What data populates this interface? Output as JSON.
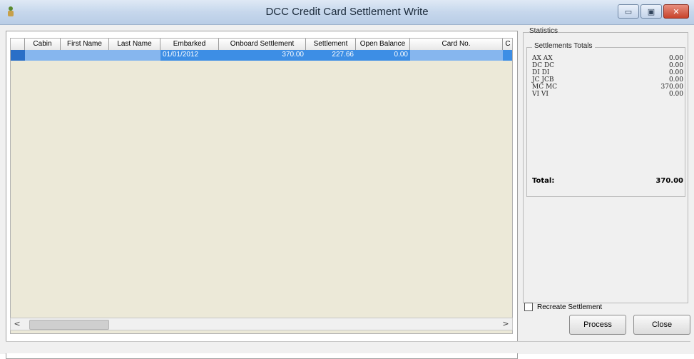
{
  "window": {
    "title": "DCC Credit Card Settlement Write",
    "minimize_symbol": "▭",
    "maximize_symbol": "▣",
    "close_symbol": "✕"
  },
  "grid": {
    "columns": [
      "Cabin",
      "First Name",
      "Last Name",
      "Embarked",
      "Onboard Settlement",
      "Settlement",
      "Open Balance",
      "Card No.",
      "C"
    ],
    "rows": [
      {
        "cabin": "",
        "first_name": "",
        "last_name": "",
        "embarked": "01/01/2012",
        "onboard_settlement": "370.00",
        "settlement": "227.66",
        "open_balance": "0.00",
        "card_no": "",
        "c": ""
      }
    ],
    "scroll_left": "<",
    "scroll_right": ">"
  },
  "statistics": {
    "label": "Statistics",
    "totals_label": "Settlements Totals",
    "items": [
      {
        "code": "AX  AX",
        "amount": "0.00"
      },
      {
        "code": "DC  DC",
        "amount": "0.00"
      },
      {
        "code": "DI  DI",
        "amount": "0.00"
      },
      {
        "code": "JC  JCB",
        "amount": "0.00"
      },
      {
        "code": "MC  MC",
        "amount": "370.00"
      },
      {
        "code": "VI  VI",
        "amount": "0.00"
      }
    ],
    "total_label": "Total:",
    "total_amount": "370.00"
  },
  "options": {
    "recreate_label": "Recreate Settlement"
  },
  "buttons": {
    "process": "Process",
    "close": "Close"
  }
}
